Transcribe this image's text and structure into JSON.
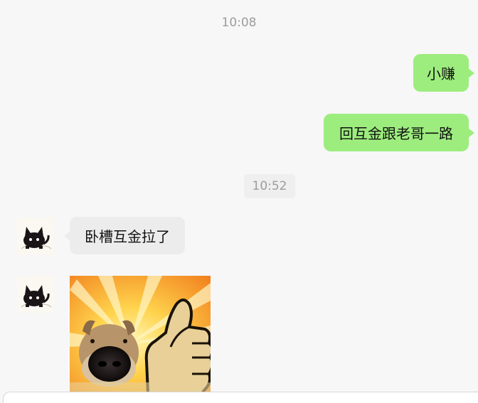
{
  "chat": {
    "timestamps": [
      "10:08",
      "10:52"
    ],
    "messages": [
      {
        "sender": "me",
        "text": "小赚"
      },
      {
        "sender": "me",
        "text": "回互金跟老哥一路"
      },
      {
        "sender": "them",
        "text": "卧槽互金拉了"
      },
      {
        "sender": "them",
        "type": "sticker",
        "icon": "dog-thumbs-up-sticker"
      }
    ],
    "avatar_icon": "black-cat-avatar",
    "colors": {
      "my_bubble": "#9ded7e",
      "their_bubble": "#ececec",
      "background": "#f7f7f7"
    }
  }
}
